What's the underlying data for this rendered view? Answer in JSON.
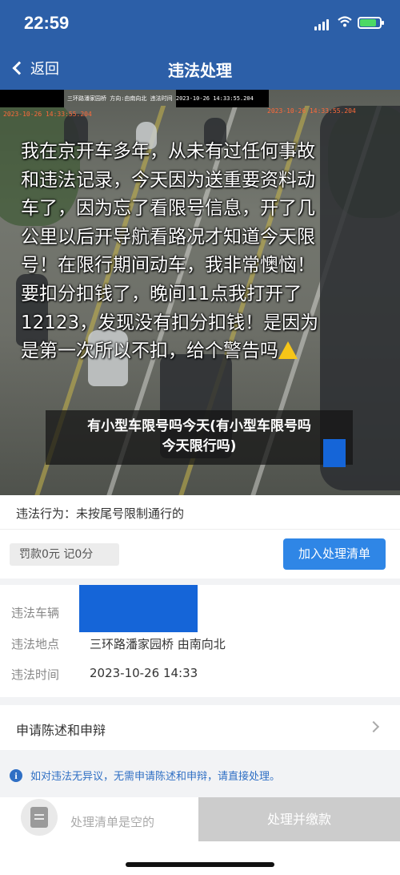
{
  "status_bar": {
    "time": "22:59"
  },
  "nav": {
    "back_label": "返回",
    "title": "违法处理"
  },
  "camera": {
    "stamp_left": "2023-10-26 14:33:55.204",
    "stamp_right": "2023-10-26 14:33:55.204",
    "top_overlay": "三环路潘家园桥 方向:由南向北 违法时间 2023-10-26 14:33:55.204",
    "overlay_lines": [
      "我在京开车多年，从未有过任何事故",
      "和违法记录，今天因为送重要资料动",
      "车了，因为忘了看限号信息，开了几",
      "公里以后开导航看路况才知道今天限",
      "号！在限行期间动车，我非常懊恼！",
      "要扣分扣钱了，晚间11点我打开了",
      "12123，发现没有扣分扣钱！是因为",
      "是第一次所以不扣，给个警告吗"
    ],
    "caption_line1": "有小型车限号吗今天(有小型车限号吗",
    "caption_line2": "今天限行吗)"
  },
  "violation": {
    "behavior": "违法行为：未按尾号限制通行的",
    "fine": "罚款0元  记0分",
    "add_button": "加入处理清单"
  },
  "details": {
    "vehicle_label": "违法车辆",
    "location_label": "违法地点",
    "location_value": "三环路潘家园桥 由南向北",
    "time_label": "违法时间",
    "time_value": "2023-10-26 14:33"
  },
  "appeal": {
    "label": "申请陈述和申辩"
  },
  "notice": {
    "text": "如对违法无异议，无需申请陈述和申辩，请直接处理。"
  },
  "bottom": {
    "empty_text": "处理清单是空的",
    "pay_button": "处理并缴款"
  },
  "colors": {
    "header": "#2c5fa8",
    "primary_button": "#2f86e6",
    "redaction": "#1565d8",
    "disabled_button": "#cccccc"
  }
}
